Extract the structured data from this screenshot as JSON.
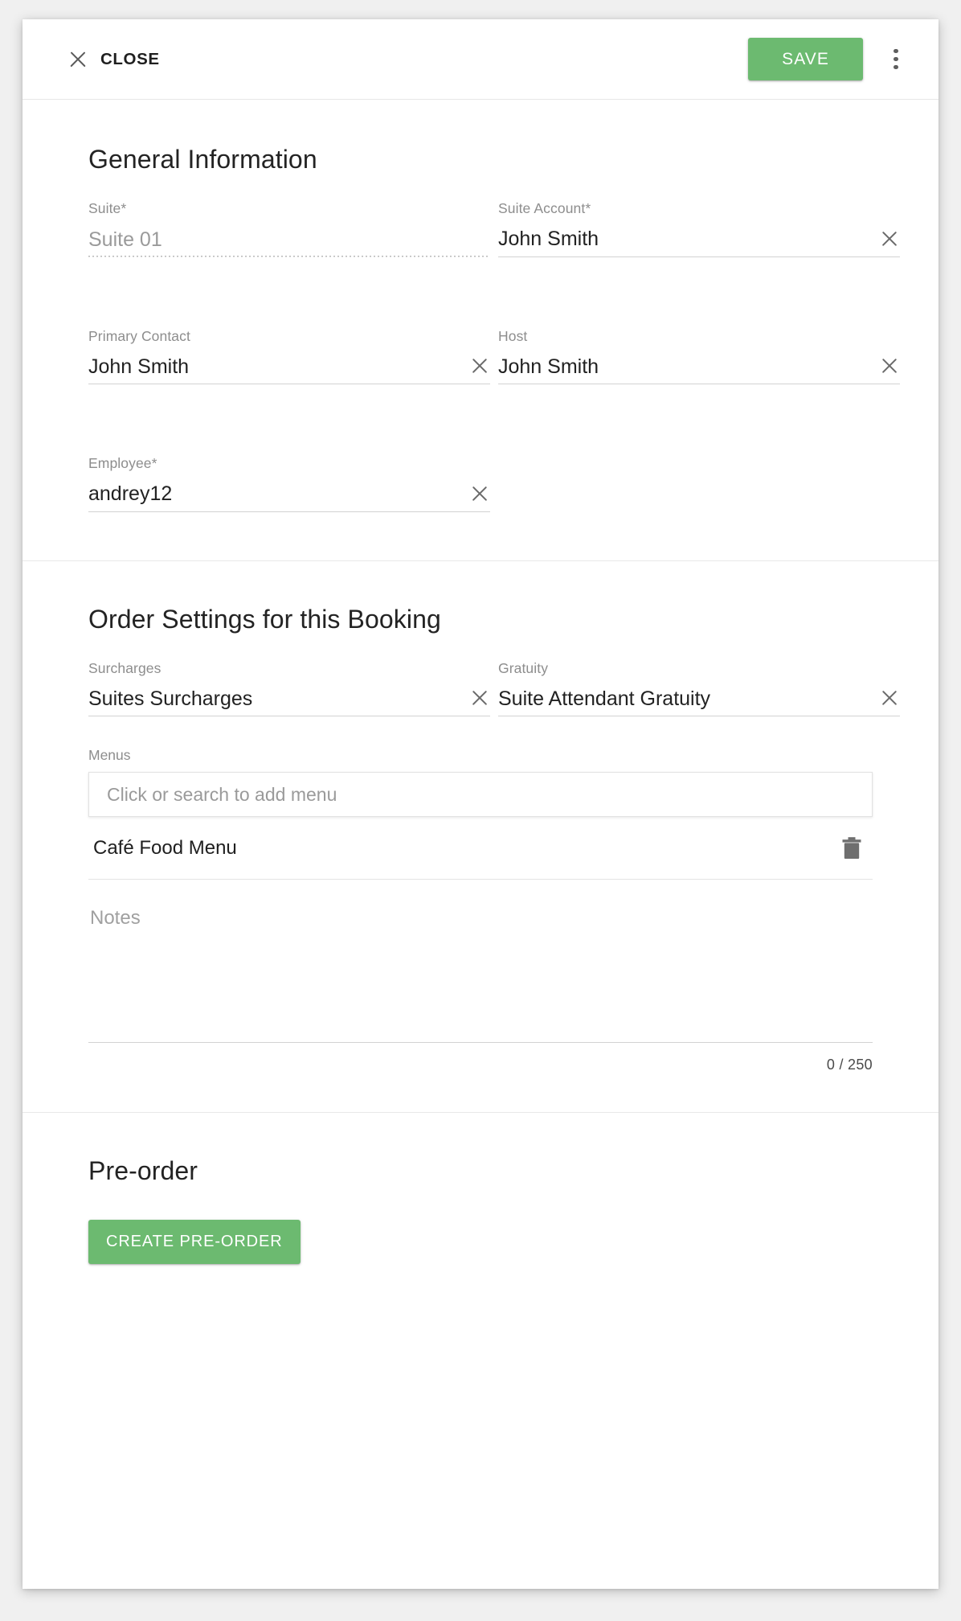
{
  "toolbar": {
    "close_label": "CLOSE",
    "save_label": "SAVE",
    "accent_color": "#6cba70"
  },
  "general": {
    "title": "General Information",
    "fields": [
      {
        "label": "Suite",
        "required_mark": "*",
        "value": "Suite 01",
        "disabled": true,
        "clearable": false
      },
      {
        "label": "Suite Account",
        "required_mark": "*",
        "value": "John Smith",
        "disabled": false,
        "clearable": true
      },
      {
        "label": "Primary Contact",
        "required_mark": "",
        "value": "John Smith",
        "disabled": false,
        "clearable": true
      },
      {
        "label": "Host",
        "required_mark": "",
        "value": "John Smith",
        "disabled": false,
        "clearable": true
      },
      {
        "label": "Employee",
        "required_mark": "*",
        "value": "andrey12",
        "disabled": false,
        "clearable": true
      }
    ]
  },
  "order_settings": {
    "title": "Order Settings for this Booking",
    "surcharges": {
      "label": "Surcharges",
      "value": "Suites Surcharges"
    },
    "gratuity": {
      "label": "Gratuity",
      "value": "Suite Attendant Gratuity"
    },
    "menus": {
      "label": "Menus",
      "search_placeholder": "Click or search to add menu",
      "items": [
        {
          "name": "Café Food Menu"
        }
      ]
    },
    "notes": {
      "placeholder": "Notes",
      "value": "",
      "counter": "0 / 250"
    }
  },
  "preorder": {
    "title": "Pre-order",
    "create_label": "CREATE PRE-ORDER"
  }
}
